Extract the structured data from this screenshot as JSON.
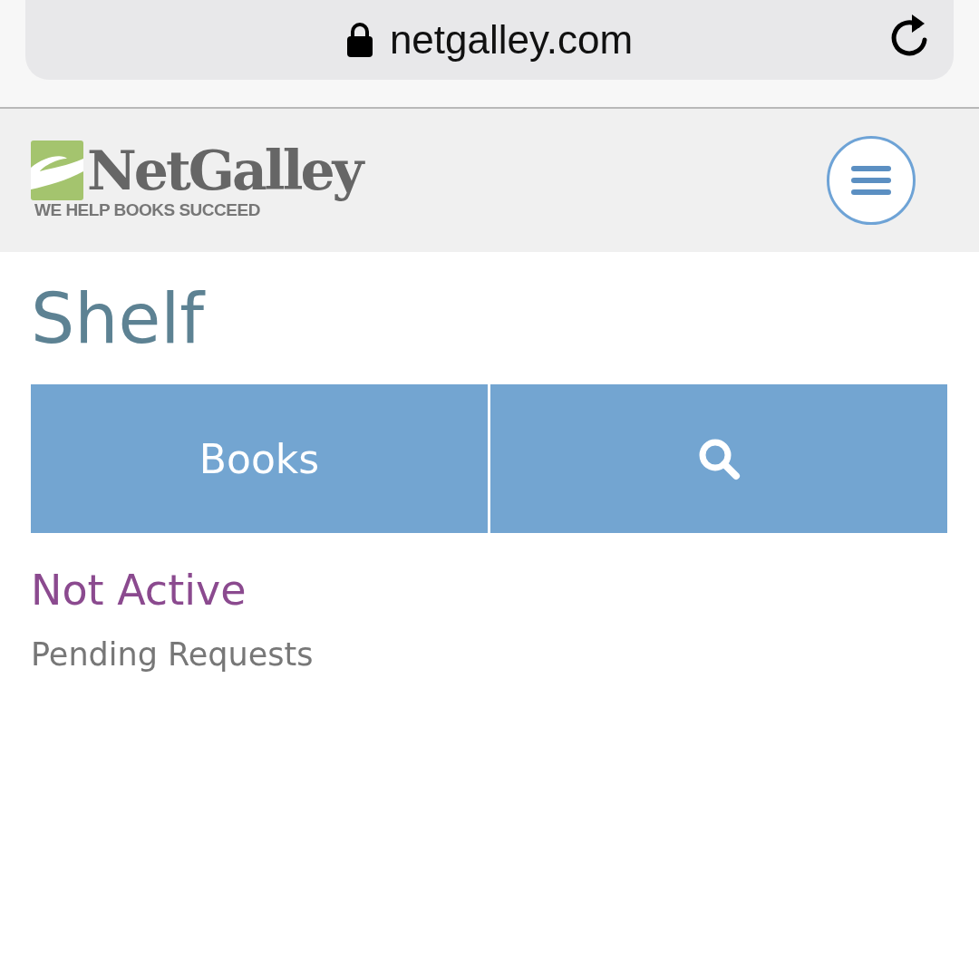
{
  "address_bar": {
    "url": "netgalley.com"
  },
  "logo": {
    "name": "NetGalley",
    "tagline": "WE HELP BOOKS SUCCEED"
  },
  "page": {
    "title": "Shelf"
  },
  "tabs": [
    {
      "kind": "text",
      "label": "Books"
    },
    {
      "kind": "search"
    }
  ],
  "section": {
    "title": "Not Active",
    "items": [
      "Pending Requests"
    ]
  }
}
